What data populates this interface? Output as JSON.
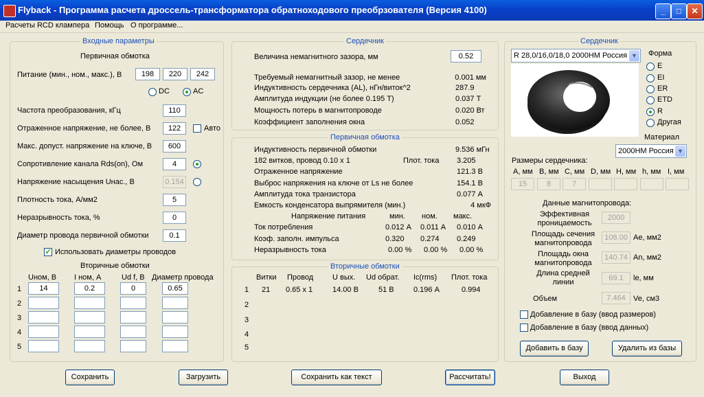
{
  "window": {
    "title": "Flyback - Программа расчета дроссель-трансформатора обратноходового преобрзователя (Версия 4100)",
    "min": "_",
    "max": "□",
    "close": "✕"
  },
  "menu": [
    "Расчеты RCD клампера",
    "Помощь",
    "О программе..."
  ],
  "input": {
    "group_title": "Входные параметры",
    "primary_title": "Первичная обмотка",
    "supply_label": "Питание (мин., ном., макс.), В",
    "supply": [
      "198",
      "220",
      "242"
    ],
    "dc_label": "DC",
    "ac_label": "AC",
    "freq_label": "Частота преобразования, кГц",
    "freq": "110",
    "refl_label": "Отраженное напряжение, не более, В",
    "refl": "122",
    "auto_label": "Авто",
    "vmax_label": "Макс. допуст. напряжение на ключе, В",
    "vmax": "600",
    "rds_label": "Сопротивление канала Rds(on), Ом",
    "rds": "4",
    "usat_label": "Напряжение насыщения Uнас., В",
    "usat": "0.154",
    "jdens_label": "Плотность тока, А/мм2",
    "jdens": "5",
    "cont_label": "Неразрывность тока, %",
    "cont": "0",
    "wire_label": "Диаметр провода первичной обмотки",
    "wire": "0.1",
    "use_diam_label": "Использовать диаметры проводов",
    "secondary_title": "Вторичные обмотки",
    "sec_headers": [
      "Uном, В",
      "I ном, А",
      "Ud f, В",
      "Диаметр провода"
    ],
    "sec_rows": [
      {
        "n": "1",
        "u": "14",
        "i": "0.2",
        "ud": "0",
        "d": "0.65"
      },
      {
        "n": "2",
        "u": "",
        "i": "",
        "ud": "",
        "d": ""
      },
      {
        "n": "3",
        "u": "",
        "i": "",
        "ud": "",
        "d": ""
      },
      {
        "n": "4",
        "u": "",
        "i": "",
        "ud": "",
        "d": ""
      },
      {
        "n": "5",
        "u": "",
        "i": "",
        "ud": "",
        "d": ""
      }
    ]
  },
  "core_mid": {
    "title": "Сердечник",
    "gap_label": "Величина немагнитного зазора, мм",
    "gap": "0.52",
    "rows": [
      {
        "label": "Требуемый немагнитный зазор, не менее",
        "value": "0.001 мм"
      },
      {
        "label": "Индуктивность сердечника (AL), нГн/виток^2",
        "value": "287.9"
      },
      {
        "label": "Амплитуда индукции     (не более 0.195 Т)",
        "value": "0.037 Т"
      },
      {
        "label": "Мощность потерь в магнитопроводе",
        "value": "0.020 Вт"
      },
      {
        "label": "Коэффициент заполнения окна",
        "value": "0.052"
      }
    ]
  },
  "primary": {
    "title": "Первичная обмотка",
    "ind_label": "Индуктивность первичной обмотки",
    "ind": "9.536 мГн",
    "turns_label": " 182 витков,  провод 0.10 x 1",
    "density_label": "Плот. тока",
    "density": "3.205",
    "rows": [
      {
        "label": "Отраженное напряжение",
        "value": "121.3 В"
      },
      {
        "label": "Выброс напряжения на ключе от Ls не более",
        "value": "154.1 В"
      },
      {
        "label": "Амплитуда тока транзистора",
        "value": "0.077 А"
      },
      {
        "label": "Емкость конденсатора выпрямителя (мин.)",
        "value": "4 мкФ"
      }
    ],
    "table_headers": [
      "Напряжение питания",
      "мин.",
      "ном.",
      "макс."
    ],
    "table": [
      {
        "label": "Ток потребления",
        "v": [
          "0.012 А",
          "0.011 А",
          "0.010 А"
        ]
      },
      {
        "label": "Коэф. заполн. импульса",
        "v": [
          "0.320",
          "0.274",
          "0.249"
        ]
      },
      {
        "label": "Неразрывность тока",
        "v": [
          "0.00 %",
          "0.00 %",
          "0.00 %"
        ]
      }
    ]
  },
  "secondary_out": {
    "title": "Вторичные обмотки",
    "headers": [
      "Витки",
      "Провод",
      "U вых.",
      "Ud обрат.",
      "Ic(rms)",
      "Плот. тока"
    ],
    "rows": [
      {
        "n": "1",
        "v": [
          "21",
          "0.65 x 1",
          "14.00 В",
          "51 В",
          "0.196 А",
          "0.994"
        ]
      },
      {
        "n": "2",
        "v": [
          "",
          "",
          "",
          "",
          "",
          ""
        ]
      },
      {
        "n": "3",
        "v": [
          "",
          "",
          "",
          "",
          "",
          ""
        ]
      },
      {
        "n": "4",
        "v": [
          "",
          "",
          "",
          "",
          "",
          ""
        ]
      },
      {
        "n": "5",
        "v": [
          "",
          "",
          "",
          "",
          "",
          ""
        ]
      }
    ]
  },
  "core_right": {
    "title": "Сердечник",
    "core_select": "R 28,0/16,0/18,0 2000НМ Россия",
    "shape_label": "Форма",
    "shapes": [
      {
        "label": "E",
        "on": false
      },
      {
        "label": "EI",
        "on": false
      },
      {
        "label": "ER",
        "on": false
      },
      {
        "label": "ETD",
        "on": false
      },
      {
        "label": "R",
        "on": true
      },
      {
        "label": "Другая",
        "on": false
      }
    ],
    "material_label": "Материал",
    "material": "2000НМ Россия",
    "dims_label": "Размеры сердечника:",
    "dims": [
      {
        "h": "A, мм",
        "v": "15"
      },
      {
        "h": "B, мм",
        "v": "8"
      },
      {
        "h": "C, мм",
        "v": "7"
      },
      {
        "h": "D, мм",
        "v": ""
      },
      {
        "h": "H, мм",
        "v": ""
      },
      {
        "h": "h, мм",
        "v": ""
      },
      {
        "h": "I, мм",
        "v": ""
      }
    ],
    "mag_title": "Данные магнитопровода:",
    "mag": [
      {
        "label": "Эффективная проницаемость",
        "value": "2000",
        "unit": ""
      },
      {
        "label": "Площадь сечения магнитопровода",
        "value": "108.00",
        "unit": "Ae, мм2"
      },
      {
        "label": "Площадь окна магнитопровода",
        "value": "140.74",
        "unit": "An, мм2"
      },
      {
        "label": "Длина средней линии",
        "value": "69.1",
        "unit": "le, мм"
      },
      {
        "label": "Объем",
        "value": "7.464",
        "unit": "Ve, см3"
      }
    ],
    "add_dims": "Добавление в базу (ввод размеров)",
    "add_data": "Добавление в базу (ввод данных)",
    "add_btn": "Добавить в базу",
    "del_btn": "Удалить из базы"
  },
  "bottom": {
    "save": "Сохранить",
    "load": "Загрузить",
    "save_text": "Сохранить как текст",
    "calc": "Рассчитать!",
    "exit": "Выход"
  },
  "colors": {
    "titlebar": "#0a5fe0",
    "group_title": "#1c4fb8",
    "face": "#ece9d8"
  }
}
